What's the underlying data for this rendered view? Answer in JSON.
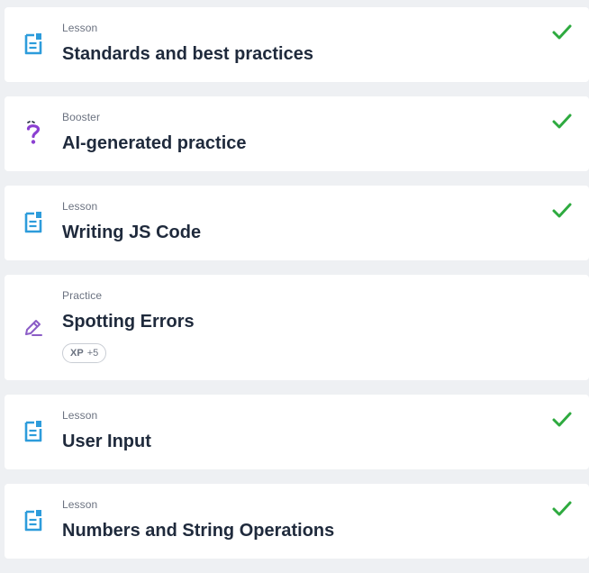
{
  "colors": {
    "lesson_icon": "#2d9cdb",
    "booster_icon": "#8b3fd1",
    "practice_icon": "#8b5cc6",
    "check": "#2eaa3f",
    "title": "#1f2a3c",
    "label": "#6b7280"
  },
  "items": [
    {
      "type": "Lesson",
      "title": "Standards and best practices",
      "icon": "lesson-document-icon",
      "completed": true
    },
    {
      "type": "Booster",
      "title": "AI-generated practice",
      "icon": "question-mark-icon",
      "completed": true
    },
    {
      "type": "Lesson",
      "title": "Writing JS Code",
      "icon": "lesson-document-icon",
      "completed": true
    },
    {
      "type": "Practice",
      "title": "Spotting Errors",
      "icon": "pencil-icon",
      "completed": false,
      "xp_label": "XP",
      "xp_value": "+5"
    },
    {
      "type": "Lesson",
      "title": "User Input",
      "icon": "lesson-document-icon",
      "completed": true
    },
    {
      "type": "Lesson",
      "title": "Numbers and String Operations",
      "icon": "lesson-document-icon",
      "completed": true
    }
  ]
}
